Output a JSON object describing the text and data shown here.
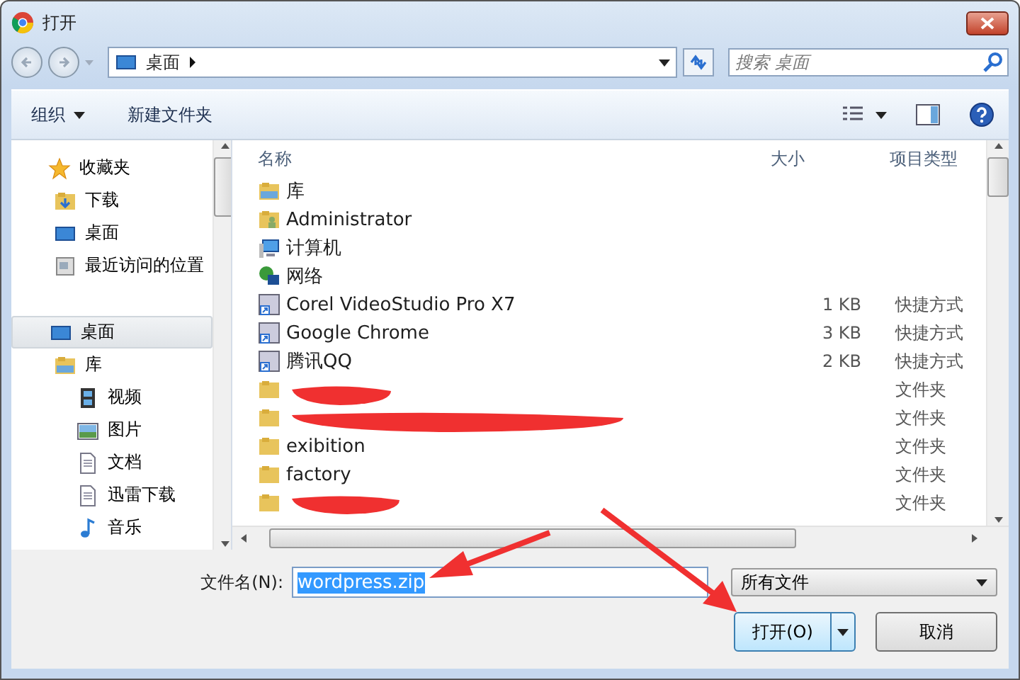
{
  "window": {
    "title": "打开"
  },
  "address": {
    "location": "桌面"
  },
  "search": {
    "placeholder": "搜索 桌面"
  },
  "toolbar": {
    "organize": "组织",
    "new_folder": "新建文件夹"
  },
  "sidebar": {
    "items": [
      {
        "label": "收藏夹",
        "kind": "star",
        "selected": false,
        "children": [
          {
            "label": "下载",
            "kind": "download",
            "selected": false
          },
          {
            "label": "桌面",
            "kind": "desktop",
            "selected": false
          },
          {
            "label": "最近访问的位置",
            "kind": "recent",
            "selected": false
          }
        ]
      },
      {
        "label": "桌面",
        "kind": "desktop",
        "selected": true,
        "children": [
          {
            "label": "库",
            "kind": "library",
            "selected": false,
            "children": [
              {
                "label": "视频",
                "kind": "video",
                "selected": false
              },
              {
                "label": "图片",
                "kind": "image",
                "selected": false
              },
              {
                "label": "文档",
                "kind": "document",
                "selected": false
              },
              {
                "label": "迅雷下载",
                "kind": "document",
                "selected": false
              },
              {
                "label": "音乐",
                "kind": "music",
                "selected": false
              }
            ]
          }
        ]
      }
    ]
  },
  "table": {
    "columns": [
      "名称",
      "大小",
      "项目类型"
    ],
    "rows": [
      {
        "name": "库",
        "kind": "library"
      },
      {
        "name": "Administrator",
        "kind": "user"
      },
      {
        "name": "计算机",
        "kind": "computer"
      },
      {
        "name": "网络",
        "kind": "network"
      },
      {
        "name": "Corel VideoStudio Pro X7",
        "kind": "shortcut",
        "size": "1 KB",
        "type": "快捷方式"
      },
      {
        "name": "Google Chrome",
        "kind": "shortcut",
        "size": "3 KB",
        "type": "快捷方式"
      },
      {
        "name": "腾讯QQ",
        "kind": "shortcut",
        "size": "2 KB",
        "type": "快捷方式"
      },
      {
        "kind": "folder",
        "type": "文件夹"
      },
      {
        "kind": "folder",
        "type": "文件夹"
      },
      {
        "name": "exibition",
        "kind": "folder",
        "type": "文件夹"
      },
      {
        "name": "factory",
        "kind": "folder",
        "type": "文件夹"
      },
      {
        "kind": "folder",
        "type": "文件夹"
      }
    ]
  },
  "filename": {
    "label": "文件名(N):",
    "value": "wordpress.zip",
    "selected": true
  },
  "filter": {
    "value": "所有文件"
  },
  "buttons": [
    {
      "label": "打开(O)",
      "kind": "split"
    },
    {
      "label": "取消",
      "kind": "plain"
    }
  ]
}
